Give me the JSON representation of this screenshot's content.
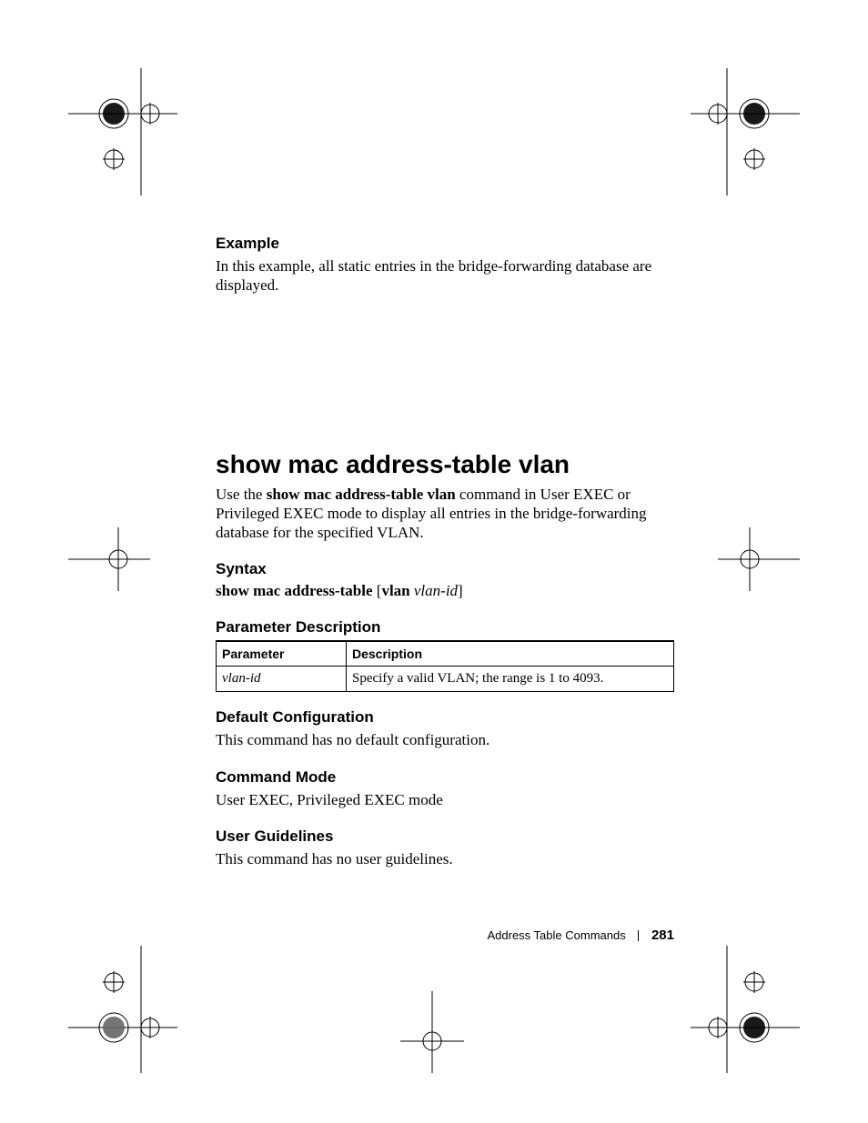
{
  "sections": {
    "example": {
      "heading": "Example",
      "body": "In this example, all static entries in the bridge-forwarding database are displayed."
    },
    "command": {
      "title": "show mac address-table vlan",
      "intro_prefix": "Use the ",
      "intro_bold": "show mac address-table vlan",
      "intro_suffix": " command in User EXEC or Privileged EXEC mode to display all entries in the bridge-forwarding database for the specified VLAN."
    },
    "syntax": {
      "heading": "Syntax",
      "bold1": "show mac address-table",
      "mid1": " [",
      "bold2": "vlan",
      "mid2": " ",
      "ital": "vlan-id",
      "end": "]"
    },
    "paramdesc": {
      "heading": "Parameter Description",
      "table": {
        "headers": [
          "Parameter",
          "Description"
        ],
        "rows": [
          {
            "param": "vlan-id",
            "desc": "Specify a valid VLAN; the range is 1 to 4093."
          }
        ]
      }
    },
    "defcfg": {
      "heading": "Default Configuration",
      "body": "This command has no default configuration."
    },
    "cmdmode": {
      "heading": "Command Mode",
      "body": "User EXEC, Privileged EXEC mode"
    },
    "userg": {
      "heading": "User Guidelines",
      "body": "This command has no user guidelines."
    }
  },
  "footer": {
    "section": "Address Table Commands",
    "page": "281"
  }
}
